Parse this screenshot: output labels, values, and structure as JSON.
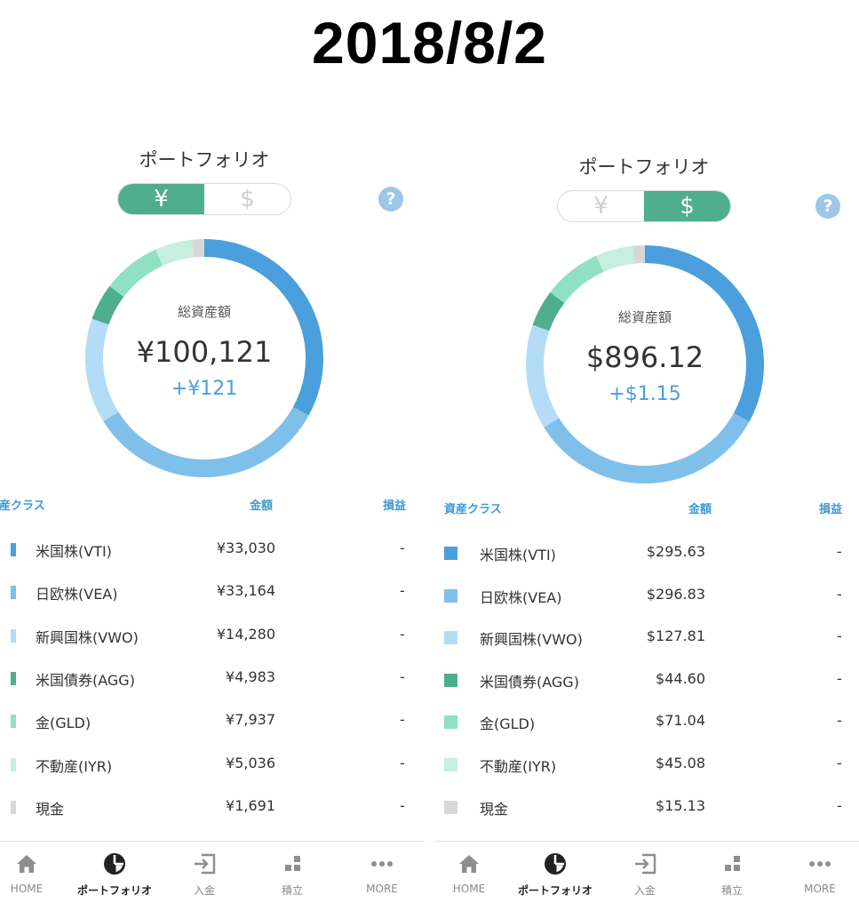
{
  "date_title": "2018/8/2",
  "colors": {
    "vti": "#4a9fdc",
    "vea": "#7ec0ea",
    "vwo": "#b4dcf7",
    "agg": "#4eae8e",
    "gld": "#90e0c4",
    "iyr": "#c6efe0",
    "cash": "#d8d8d8",
    "accent_green": "#4eae8e",
    "accent_blue": "#3f9ad6"
  },
  "panels": [
    {
      "title": "ポートフォリオ",
      "toggle": {
        "yen": "¥",
        "usd": "$",
        "active": "yen"
      },
      "help": "?",
      "summary": {
        "label": "総資産額",
        "total": "¥100,121",
        "gain": "+¥121"
      },
      "table": {
        "headers": {
          "asset": "資産クラス",
          "amount": "金額",
          "pl": "損益"
        },
        "rows": [
          {
            "name": "米国株(VTI)",
            "amount": "¥33,030",
            "pl": "-",
            "color": "#4a9fdc",
            "value": 33030
          },
          {
            "name": "日欧株(VEA)",
            "amount": "¥33,164",
            "pl": "-",
            "color": "#7ec0ea",
            "value": 33164
          },
          {
            "name": "新興国株(VWO)",
            "amount": "¥14,280",
            "pl": "-",
            "color": "#b4dcf7",
            "value": 14280
          },
          {
            "name": "米国債券(AGG)",
            "amount": "¥4,983",
            "pl": "-",
            "color": "#4eae8e",
            "value": 4983
          },
          {
            "name": "金(GLD)",
            "amount": "¥7,937",
            "pl": "-",
            "color": "#90e0c4",
            "value": 7937
          },
          {
            "name": "不動産(IYR)",
            "amount": "¥5,036",
            "pl": "-",
            "color": "#c6efe0",
            "value": 5036
          },
          {
            "name": "現金",
            "amount": "¥1,691",
            "pl": "-",
            "color": "#d8d8d8",
            "value": 1691
          }
        ]
      },
      "nav": [
        {
          "label": "HOME",
          "icon": "home-icon"
        },
        {
          "label": "ポートフォリオ",
          "icon": "pie-chart-icon",
          "active": true
        },
        {
          "label": "入金",
          "icon": "deposit-icon"
        },
        {
          "label": "積立",
          "icon": "accumulate-icon"
        },
        {
          "label": "MORE",
          "icon": "more-icon"
        }
      ]
    },
    {
      "title": "ポートフォリオ",
      "toggle": {
        "yen": "¥",
        "usd": "$",
        "active": "usd"
      },
      "help": "?",
      "summary": {
        "label": "総資産額",
        "total": "$896.12",
        "gain": "+$1.15"
      },
      "table": {
        "headers": {
          "asset": "資産クラス",
          "amount": "金額",
          "pl": "損益"
        },
        "rows": [
          {
            "name": "米国株(VTI)",
            "amount": "$295.63",
            "pl": "-",
            "color": "#4a9fdc",
            "value": 295.63
          },
          {
            "name": "日欧株(VEA)",
            "amount": "$296.83",
            "pl": "-",
            "color": "#7ec0ea",
            "value": 296.83
          },
          {
            "name": "新興国株(VWO)",
            "amount": "$127.81",
            "pl": "-",
            "color": "#b4dcf7",
            "value": 127.81
          },
          {
            "name": "米国債券(AGG)",
            "amount": "$44.60",
            "pl": "-",
            "color": "#4eae8e",
            "value": 44.6
          },
          {
            "name": "金(GLD)",
            "amount": "$71.04",
            "pl": "-",
            "color": "#90e0c4",
            "value": 71.04
          },
          {
            "name": "不動産(IYR)",
            "amount": "$45.08",
            "pl": "-",
            "color": "#c6efe0",
            "value": 45.08
          },
          {
            "name": "現金",
            "amount": "$15.13",
            "pl": "-",
            "color": "#d8d8d8",
            "value": 15.13
          }
        ]
      },
      "nav": [
        {
          "label": "HOME",
          "icon": "home-icon"
        },
        {
          "label": "ポートフォリオ",
          "icon": "pie-chart-icon",
          "active": true
        },
        {
          "label": "入金",
          "icon": "deposit-icon"
        },
        {
          "label": "積立",
          "icon": "accumulate-icon"
        },
        {
          "label": "MORE",
          "icon": "more-icon"
        }
      ]
    }
  ]
}
